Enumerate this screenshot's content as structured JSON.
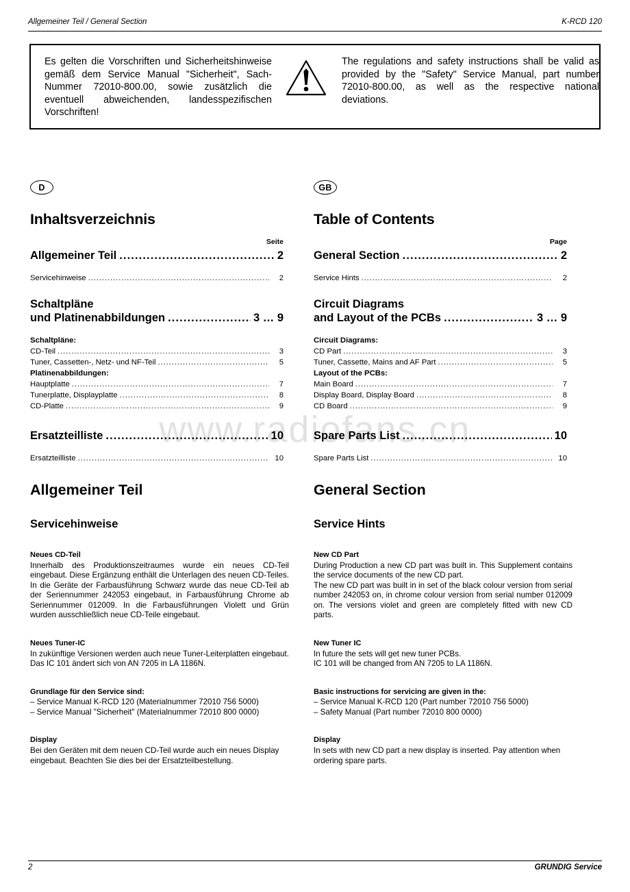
{
  "header": {
    "left": "Allgemeiner Teil / General Section",
    "right": "K-RCD 120"
  },
  "watermark": "www.radiofans.cn",
  "warning": {
    "icon": "warning-triangle-icon",
    "german": "Es gelten die Vorschriften und Sicherheitshinweise gemäß dem Service Manual \"Sicherheit\", Sach-Nummer 72010-800.00, sowie zusätzlich die eventuell abweichenden, landesspezifischen Vorschriften!",
    "english": "The regulations and safety instructions shall be valid as provided by the \"Safety\" Service Manual, part number 72010-800.00, as well as the respective national deviations."
  },
  "toc_de": {
    "badge": "D",
    "title": "Inhaltsverzeichnis",
    "page_label": "Seite",
    "entry1_title": "Allgemeiner Teil",
    "entry1_page": "2",
    "entry1_sub_label": "Servicehinweise",
    "entry1_sub_page": "2",
    "entry2_line1": "Schaltpläne",
    "entry2_line2": "und Platinenabbildungen",
    "entry2_page": "3 … 9",
    "group1_head": "Schaltpläne:",
    "group1_items": [
      {
        "label": "CD-Teil",
        "page": "3"
      },
      {
        "label": "Tuner, Cassetten-, Netz- und NF-Teil",
        "page": "5"
      }
    ],
    "group2_head": "Platinenabbildungen:",
    "group2_items": [
      {
        "label": "Hauptplatte",
        "page": "7"
      },
      {
        "label": "Tunerplatte, Displayplatte",
        "page": "8"
      },
      {
        "label": "CD-Platte",
        "page": "9"
      }
    ],
    "entry3_title": "Ersatzteilliste",
    "entry3_page": "10",
    "entry3_sub_label": "Ersatzteilliste",
    "entry3_sub_page": "10"
  },
  "toc_gb": {
    "badge": "GB",
    "title": "Table of Contents",
    "page_label": "Page",
    "entry1_title": "General Section",
    "entry1_page": "2",
    "entry1_sub_label": "Service Hints",
    "entry1_sub_page": "2",
    "entry2_line1": "Circuit Diagrams",
    "entry2_line2": "and Layout of the PCBs",
    "entry2_page": "3 … 9",
    "group1_head": "Circuit Diagrams:",
    "group1_items": [
      {
        "label": "CD Part",
        "page": "3"
      },
      {
        "label": "Tuner, Cassette, Mains and AF Part",
        "page": "5"
      }
    ],
    "group2_head": "Layout of the PCBs:",
    "group2_items": [
      {
        "label": "Main Board",
        "page": "7"
      },
      {
        "label": "Display Board, Display Board",
        "page": "8"
      },
      {
        "label": "CD Board",
        "page": "9"
      }
    ],
    "entry3_title": "Spare Parts List",
    "entry3_page": "10",
    "entry3_sub_label": "Spare Parts List",
    "entry3_sub_page": "10"
  },
  "body_de": {
    "section_title": "Allgemeiner Teil",
    "section_sub": "Servicehinweise",
    "b1_head": "Neues CD-Teil",
    "b1_text": "Innerhalb des Produktionszeitraumes wurde ein neues CD-Teil eingebaut. Diese Ergänzung enthält die Unterlagen des neuen CD-Teiles. In die Geräte der Farbausführung Schwarz wurde das neue CD-Teil ab der Seriennummer 242053 eingebaut, in Farbausführung Chrome ab Seriennummer 012009. In die Farbausführungen Violett und Grün wurden ausschließlich neue CD-Teile eingebaut.",
    "b2_head": "Neues Tuner-IC",
    "b2_text": "In zukünftige Versionen werden auch neue Tuner-Leiterplatten eingebaut. Das IC 101 ändert sich von AN 7205 in LA 1186N.",
    "b3_head": "Grundlage für den Service sind:",
    "b3_line1": "– Service Manual K-RCD 120 (Materialnummer 72010 756 5000)",
    "b3_line2": "– Service Manual \"Sicherheit\" (Materialnummer 72010 800 0000)",
    "b4_head": "Display",
    "b4_text": "Bei den Geräten mit dem neuen CD-Teil wurde auch ein neues Display eingebaut. Beachten Sie dies bei der Ersatzteilbestellung."
  },
  "body_gb": {
    "section_title": "General Section",
    "section_sub": "Service Hints",
    "b1_head": "New CD Part",
    "b1_text_l1": "During Production a new CD part was built in. This Supplement contains the service documents of the new CD part.",
    "b1_text_l2": "The new CD part was built in in set of the black colour version from serial number 242053 on, in chrome colour version from serial number 012009 on. The versions violet and green are completely fitted with new CD parts.",
    "b2_head": "New Tuner IC",
    "b2_text_l1": "In future the sets will get new tuner PCBs.",
    "b2_text_l2": "IC 101 will be changed from AN 7205 to LA 1186N.",
    "b3_head": "Basic instructions for servicing are given in the:",
    "b3_line1": "– Service Manual K-RCD 120 (Part number 72010 756 5000)",
    "b3_line2": "– Safety Manual (Part number 72010 800 0000)",
    "b4_head": "Display",
    "b4_text": "In sets with new CD part a new display is inserted. Pay attention when ordering spare parts."
  },
  "footer": {
    "page_number": "2",
    "brand": "GRUNDIG Service"
  }
}
